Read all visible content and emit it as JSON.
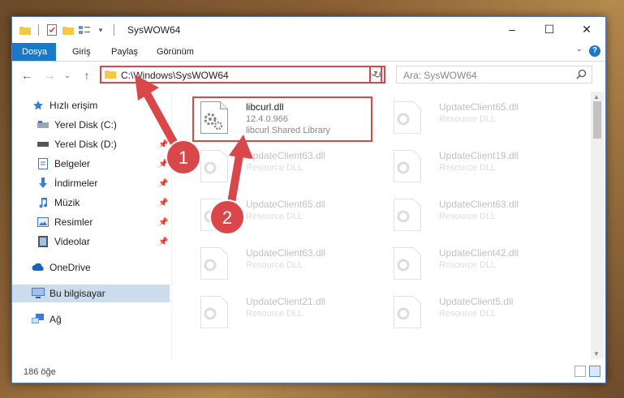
{
  "window": {
    "title": "SysWOW64",
    "controls": {
      "minimize": "–",
      "maximize": "☐",
      "close": "✕"
    }
  },
  "ribbon": {
    "tabs": [
      "Dosya",
      "Giriş",
      "Paylaş",
      "Görünüm"
    ],
    "help": "?"
  },
  "nav": {
    "address": "C:\\Windows\\SysWOW64",
    "search_placeholder": "Ara: SysWOW64"
  },
  "sidebar": {
    "items": [
      {
        "label": "Hızlı erişim",
        "icon": "star-icon"
      },
      {
        "label": "Yerel Disk (C:)",
        "icon": "drive-icon"
      },
      {
        "label": "Yerel Disk (D:)",
        "icon": "drive-icon"
      },
      {
        "label": "Belgeler",
        "icon": "documents-icon"
      },
      {
        "label": "İndirmeler",
        "icon": "download-icon"
      },
      {
        "label": "Müzik",
        "icon": "music-icon"
      },
      {
        "label": "Resimler",
        "icon": "pictures-icon"
      },
      {
        "label": "Videolar",
        "icon": "video-icon"
      },
      {
        "label": "OneDrive",
        "icon": "cloud-icon"
      },
      {
        "label": "Bu bilgisayar",
        "icon": "computer-icon"
      },
      {
        "label": "Ağ",
        "icon": "network-icon"
      }
    ]
  },
  "files": {
    "highlighted": {
      "name": "libcurl.dll",
      "version": "12.4.0.966",
      "description": "libcurl Shared Library"
    },
    "left_column": [
      {
        "name": "UpdateClient63.dll",
        "type": "Resource DLL"
      },
      {
        "name": "UpdateClient65.dll",
        "type": "Resource DLL"
      },
      {
        "name": "UpdateClient63.dll",
        "type": "Resource DLL"
      },
      {
        "name": "UpdateClient21.dll",
        "type": "Resource DLL"
      }
    ],
    "right_column": [
      {
        "name": "UpdateClient65.dll",
        "type": "Resource DLL"
      },
      {
        "name": "UpdateClient19.dll",
        "type": "Resource DLL"
      },
      {
        "name": "UpdateClient63.dll",
        "type": "Resource DLL"
      },
      {
        "name": "UpdateClient42.dll",
        "type": "Resource DLL"
      },
      {
        "name": "UpdateClient5.dll",
        "type": "Resource DLL"
      }
    ]
  },
  "status": {
    "count": "186 öğe"
  },
  "annotations": {
    "step1": "1",
    "step2": "2",
    "accent": "#d9474b"
  }
}
